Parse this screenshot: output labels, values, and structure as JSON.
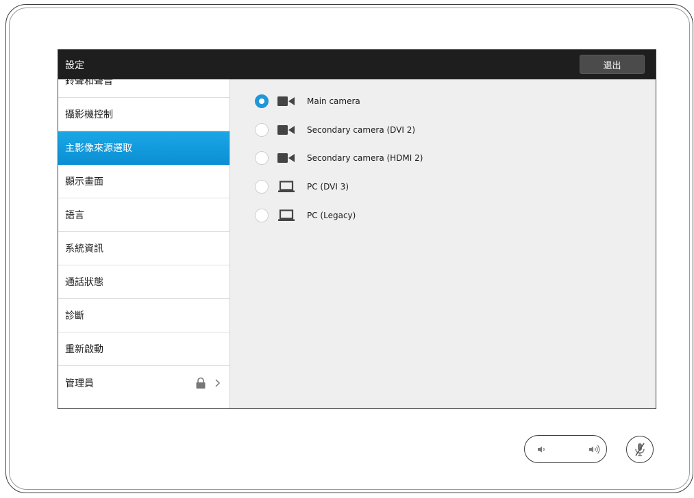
{
  "header": {
    "title": "設定",
    "exit_label": "退出"
  },
  "sidebar": {
    "items": [
      {
        "label": "鈴聲和聲音",
        "active": false
      },
      {
        "label": "攝影機控制",
        "active": false
      },
      {
        "label": "主影像來源選取",
        "active": true
      },
      {
        "label": "顯示畫面",
        "active": false
      },
      {
        "label": "語言",
        "active": false
      },
      {
        "label": "系統資訊",
        "active": false
      },
      {
        "label": "通話狀態",
        "active": false
      },
      {
        "label": "診斷",
        "active": false
      },
      {
        "label": "重新啟動",
        "active": false
      },
      {
        "label": "管理員",
        "active": false,
        "icons": [
          "lock-icon",
          "chevron-right-icon"
        ]
      }
    ]
  },
  "sources": {
    "options": [
      {
        "label": "Main camera",
        "icon": "camera-icon",
        "selected": true
      },
      {
        "label": "Secondary camera (DVI 2)",
        "icon": "camera-icon",
        "selected": false
      },
      {
        "label": "Secondary camera (HDMI 2)",
        "icon": "camera-icon",
        "selected": false
      },
      {
        "label": "PC (DVI 3)",
        "icon": "laptop-icon",
        "selected": false
      },
      {
        "label": "PC (Legacy)",
        "icon": "laptop-icon",
        "selected": false
      }
    ]
  },
  "controls": {
    "volume_down_icon": "speaker-low-icon",
    "volume_up_icon": "speaker-high-icon",
    "mute_icon": "microphone-muted-icon"
  },
  "colors": {
    "accent": "#1f97d8",
    "active_item": "#0b8fd3",
    "titlebar": "#1e1e1e",
    "exit_button": "#4b4b4b",
    "content_bg": "#efefef",
    "icon": "#444444"
  }
}
